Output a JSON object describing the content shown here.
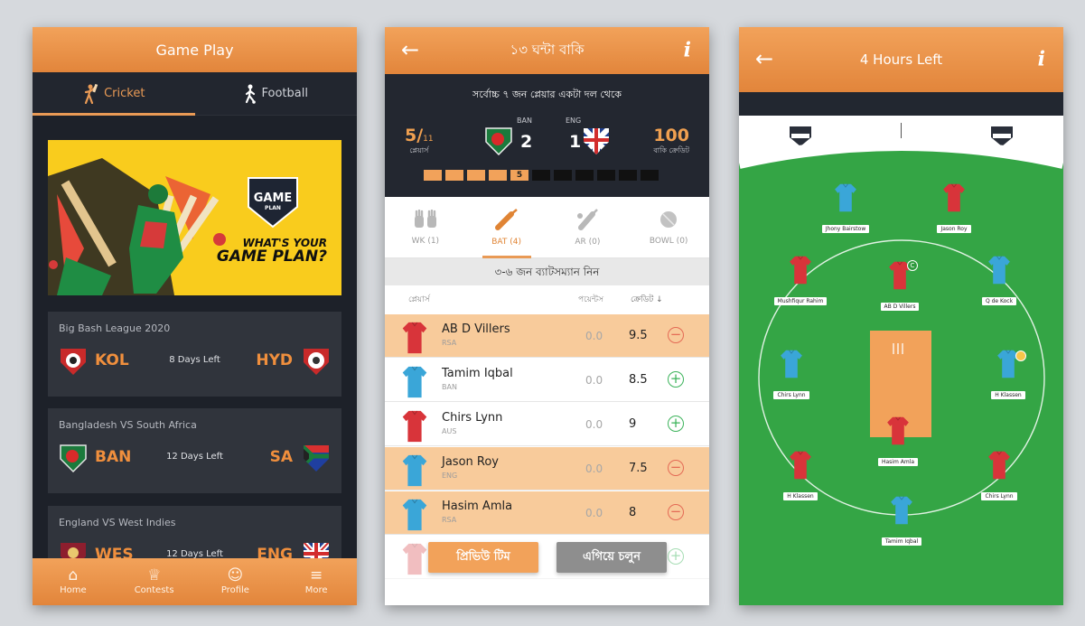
{
  "screen1": {
    "title": "Game Play",
    "tabs": [
      {
        "label": "Cricket",
        "icon": "cricket-batsman-icon"
      },
      {
        "label": "Football",
        "icon": "football-player-icon"
      }
    ],
    "banner": {
      "line1": "WHAT'S YOUR",
      "line2": "GAME PLAN?",
      "logo_top": "GAME",
      "logo_bottom": "PLAN"
    },
    "matches": [
      {
        "league": "Big Bash League 2020",
        "left": "KOL",
        "right": "HYD",
        "status": "8 Days Left"
      },
      {
        "league": "Bangladesh VS South Africa",
        "left": "BAN",
        "right": "SA",
        "status": "12 Days Left"
      },
      {
        "league": "England VS West Indies",
        "left": "WES",
        "right": "ENG",
        "status": "12 Days Left"
      }
    ],
    "nav": [
      {
        "label": "Home",
        "icon": "home-icon"
      },
      {
        "label": "Contests",
        "icon": "trophy-icon"
      },
      {
        "label": "Profile",
        "icon": "user-icon"
      },
      {
        "label": "More",
        "icon": "menu-icon"
      }
    ]
  },
  "screen2": {
    "title": "১৩ ঘন্টা বাকি",
    "subtitle": "সর্বোচ্চ ৭ জন প্লেয়ার একটা দল থেকে",
    "players_count": "5/",
    "players_total": "11",
    "players_label": "প্লেয়ার্স",
    "team1": {
      "code": "BAN",
      "count": "2"
    },
    "team2": {
      "code": "ENG",
      "count": "1"
    },
    "credit_value": "100",
    "credit_label": "বাকি ক্রেডিট",
    "progress": {
      "filled": 5,
      "total": 11,
      "current_label": "5"
    },
    "roles": [
      {
        "label": "WK (1)",
        "icon": "gloves-icon"
      },
      {
        "label": "BAT (4)",
        "icon": "bat-icon"
      },
      {
        "label": "AR (0)",
        "icon": "allrounder-icon"
      },
      {
        "label": "BOWL (0)",
        "icon": "ball-icon"
      }
    ],
    "hint": "৩-৬ জন ব্যাটসম্যান নিন",
    "columns": {
      "players": "প্লেয়ার্স",
      "points": "পয়েন্টস",
      "credit": "ক্রেডিট ↓"
    },
    "players": [
      {
        "name": "AB D Villers",
        "team": "RSA",
        "points": "0.0",
        "credit": "9.5",
        "selected": true,
        "shirt": "#d8343a"
      },
      {
        "name": "Tamim Iqbal",
        "team": "BAN",
        "points": "0.0",
        "credit": "8.5",
        "selected": false,
        "shirt": "#3aa6d8"
      },
      {
        "name": "Chirs Lynn",
        "team": "AUS",
        "points": "0.0",
        "credit": "9",
        "selected": false,
        "shirt": "#d8343a"
      },
      {
        "name": "Jason Roy",
        "team": "ENG",
        "points": "0.0",
        "credit": "7.5",
        "selected": true,
        "shirt": "#3aa6d8"
      },
      {
        "name": "Hasim Amla",
        "team": "RSA",
        "points": "0.0",
        "credit": "8",
        "selected": true,
        "shirt": "#3aa6d8"
      }
    ],
    "preview_label": "প্রিভিউ টিম",
    "next_label": "এগিয়ে চলুন"
  },
  "screen3": {
    "title": "4 Hours Left",
    "players": [
      {
        "name": "Jhony Bairstow",
        "color": "#3aa6d8"
      },
      {
        "name": "Jason Roy",
        "color": "#d8343a"
      },
      {
        "name": "Mushfiqur Rahim",
        "color": "#d8343a"
      },
      {
        "name": "AB D Villers",
        "color": "#d8343a",
        "badge": "C"
      },
      {
        "name": "Q de Kock",
        "color": "#3aa6d8"
      },
      {
        "name": "Chirs Lynn",
        "color": "#3aa6d8"
      },
      {
        "name": "H Klassen",
        "color": "#3aa6d8",
        "badge_vc": true
      },
      {
        "name": "Hasim Amla",
        "color": "#d8343a"
      },
      {
        "name": "H Klassen",
        "color": "#d8343a"
      },
      {
        "name": "Chirs Lynn",
        "color": "#d8343a"
      },
      {
        "name": "Tamim Iqbal",
        "color": "#3aa6d8"
      }
    ]
  },
  "colors": {
    "accent": "#e99a55",
    "dark": "#1d2129",
    "selected_row": "#f8cb9b",
    "pitch": "#f2a25a",
    "field": "#2f9b3e"
  }
}
